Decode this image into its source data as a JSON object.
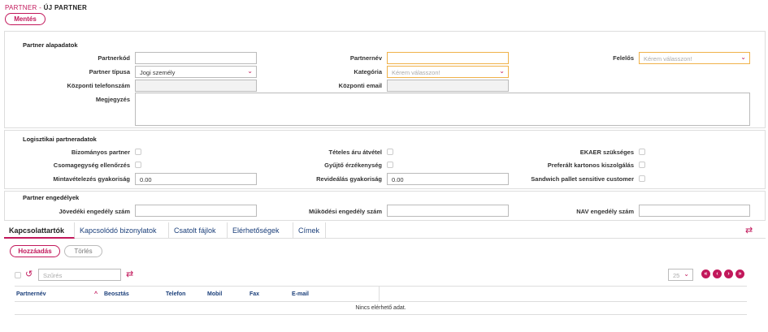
{
  "breadcrumb": {
    "parent": "PARTNER -",
    "current": "ÚJ PARTNER"
  },
  "toolbar": {
    "save_label": "Mentés"
  },
  "basic": {
    "title": "Partner alapadatok",
    "code_label": "Partnerkód",
    "code_value": "",
    "name_label": "Partnernév",
    "name_value": "",
    "responsible_label": "Felelős",
    "responsible_placeholder": "Kérem válasszon!",
    "type_label": "Partner típusa",
    "type_value": "Jogi személy",
    "category_label": "Kategória",
    "category_placeholder": "Kérem válasszon!",
    "phone_label": "Központi telefonszám",
    "phone_value": "",
    "email_label": "Központi email",
    "email_value": "",
    "note_label": "Megjegyzés",
    "note_value": ""
  },
  "logistics": {
    "title": "Logisztikai partneradatok",
    "consignment_label": "Bizományos partner",
    "itemized_label": "Tételes áru átvétel",
    "ekaer_label": "EKAER szükséges",
    "package_check_label": "Csomagegység ellenőrzés",
    "collect_label": "Gyűjtő érzékenység",
    "carton_label": "Preferált kartonos kiszolgálás",
    "sampling_label": "Mintavételezés gyakoriság",
    "sampling_value": "0.00",
    "revision_label": "Revideálás gyakoriság",
    "revision_value": "0.00",
    "sandwich_label": "Sandwich pallet sensitive customer"
  },
  "permits": {
    "title": "Partner engedélyek",
    "excise_label": "Jövedéki engedély szám",
    "excise_value": "",
    "operating_label": "Működési engedély szám",
    "operating_value": "",
    "nav_label": "NAV engedély szám",
    "nav_value": ""
  },
  "tabs": [
    {
      "label": "Kapcsolattartók"
    },
    {
      "label": "Kapcsolódó bizonylatok"
    },
    {
      "label": "Csatolt fájlok"
    },
    {
      "label": "Elérhetőségek"
    },
    {
      "label": "Címek"
    }
  ],
  "grid": {
    "add_label": "Hozzáadás",
    "delete_label": "Törlés",
    "filter_placeholder": "Szűrés",
    "page_size": "25",
    "columns": [
      "Partnernév",
      "Beosztás",
      "Telefon",
      "Mobil",
      "Fax",
      "E-mail"
    ],
    "empty_text": "Nincs elérhető adat."
  },
  "colors": {
    "accent": "#c2185b",
    "link": "#1b3f7a",
    "required_border": "#f0b24a"
  }
}
